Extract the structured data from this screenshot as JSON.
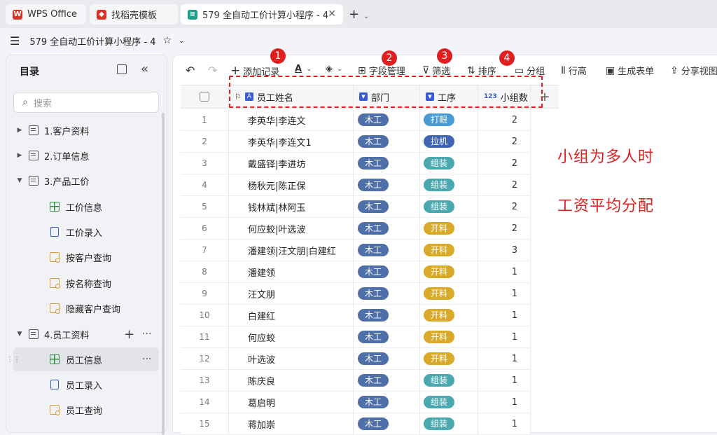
{
  "tabs": [
    {
      "label": "WPS Office",
      "color": "#d8322b"
    },
    {
      "label": "找稻壳模板",
      "color": "#d8322b"
    },
    {
      "label": "579 全自动工价计算小程序 - 4",
      "color": "#1aa08a"
    }
  ],
  "doc_title": "579 全自动工价计算小程序 - 4",
  "sidebar": {
    "title": "目录",
    "search_placeholder": "搜索",
    "items": [
      {
        "label": "1.客户资料",
        "type": "folder"
      },
      {
        "label": "2.订单信息",
        "type": "folder"
      },
      {
        "label": "3.产品工价",
        "type": "folder-open"
      },
      {
        "label": "工价信息",
        "type": "grid"
      },
      {
        "label": "工价录入",
        "type": "form"
      },
      {
        "label": "按客户查询",
        "type": "query"
      },
      {
        "label": "按名称查询",
        "type": "query"
      },
      {
        "label": "隐藏客户查询",
        "type": "query"
      },
      {
        "label": "4.员工资料",
        "type": "folder-open"
      },
      {
        "label": "员工信息",
        "type": "grid",
        "selected": true
      },
      {
        "label": "员工录入",
        "type": "form"
      },
      {
        "label": "员工查询",
        "type": "query"
      }
    ]
  },
  "toolbar": {
    "add": "添加记录",
    "fields": "字段管理",
    "filter": "筛选",
    "sort": "排序",
    "group": "分组",
    "rowheight": "行高",
    "form": "生成表单",
    "share": "分享视图"
  },
  "columns": {
    "name": "员工姓名",
    "dept": "部门",
    "process": "工序",
    "count": "小组数"
  },
  "tag_colors": {
    "木工": "#4f6fa8",
    "打眼": "#4a9ad4",
    "拉机": "#3f66b5",
    "组装": "#4aa9b0",
    "开料": "#d9aa2a"
  },
  "rows": [
    {
      "no": "1",
      "name": "李英华|李连文",
      "dept": "木工",
      "process": "打眼",
      "count": "2"
    },
    {
      "no": "2",
      "name": "李英华|李连文1",
      "dept": "木工",
      "process": "拉机",
      "count": "2"
    },
    {
      "no": "3",
      "name": "戴盛铎|李进坊",
      "dept": "木工",
      "process": "组装",
      "count": "2"
    },
    {
      "no": "4",
      "name": "杨秋元|陈正保",
      "dept": "木工",
      "process": "组装",
      "count": "2"
    },
    {
      "no": "5",
      "name": "钱林斌|林阿玉",
      "dept": "木工",
      "process": "组装",
      "count": "2"
    },
    {
      "no": "6",
      "name": "何应蛟|叶选波",
      "dept": "木工",
      "process": "开料",
      "count": "2"
    },
    {
      "no": "7",
      "name": "潘建领|汪文朋|白建红",
      "dept": "木工",
      "process": "开料",
      "count": "3"
    },
    {
      "no": "8",
      "name": "潘建领",
      "dept": "木工",
      "process": "开料",
      "count": "1"
    },
    {
      "no": "9",
      "name": "汪文朋",
      "dept": "木工",
      "process": "开料",
      "count": "1"
    },
    {
      "no": "10",
      "name": "白建红",
      "dept": "木工",
      "process": "开料",
      "count": "1"
    },
    {
      "no": "11",
      "name": "何应蛟",
      "dept": "木工",
      "process": "开料",
      "count": "1"
    },
    {
      "no": "12",
      "name": "叶选波",
      "dept": "木工",
      "process": "开料",
      "count": "1"
    },
    {
      "no": "13",
      "name": "陈庆良",
      "dept": "木工",
      "process": "组装",
      "count": "1"
    },
    {
      "no": "14",
      "name": "葛启明",
      "dept": "木工",
      "process": "组装",
      "count": "1"
    },
    {
      "no": "15",
      "name": "蒋加崇",
      "dept": "木工",
      "process": "组装",
      "count": "1"
    }
  ],
  "badges": [
    "1",
    "2",
    "3",
    "4"
  ],
  "notes": [
    "小组为多人时",
    "工资平均分配"
  ],
  "accent": "#e02020"
}
